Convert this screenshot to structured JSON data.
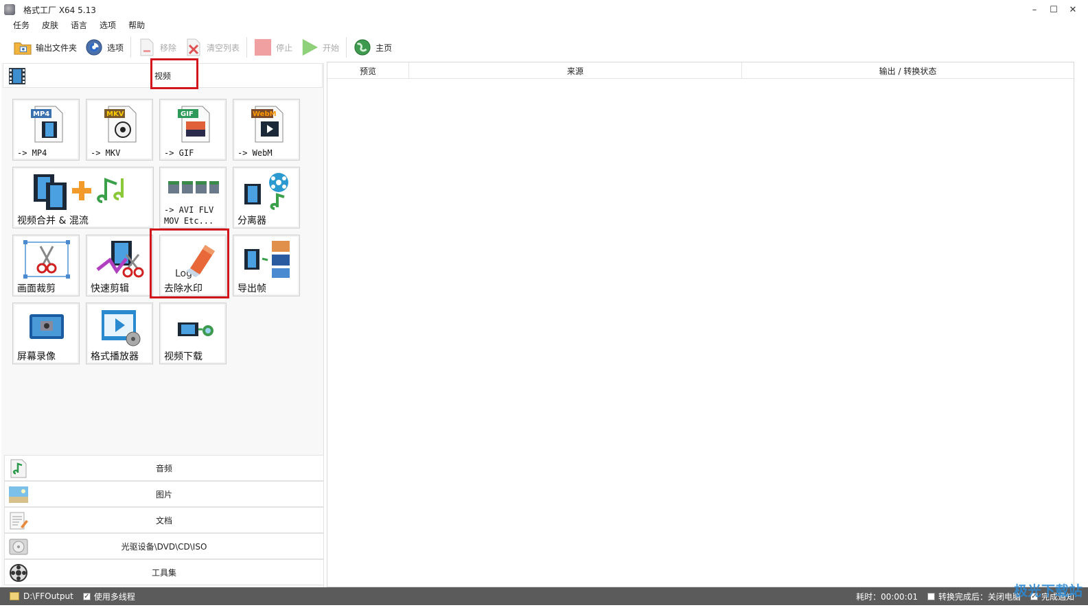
{
  "window": {
    "title": "格式工厂 X64 5.13",
    "minimize": "–",
    "maximize": "☐",
    "close": "✕"
  },
  "menu": [
    "任务",
    "皮肤",
    "语言",
    "选项",
    "帮助"
  ],
  "toolbar": {
    "output_folder": "输出文件夹",
    "options": "选项",
    "remove": "移除",
    "clear_list": "清空列表",
    "stop": "停止",
    "start": "开始",
    "home": "主页"
  },
  "video_category": {
    "label": "视频",
    "tiles": [
      {
        "label": "-> MP4",
        "icon": "mp4-file-icon",
        "badge": "MP4"
      },
      {
        "label": "-> MKV",
        "icon": "mkv-file-icon",
        "badge": "MKV"
      },
      {
        "label": "-> GIF",
        "icon": "gif-file-icon",
        "badge": "GIF"
      },
      {
        "label": "-> WebM",
        "icon": "webm-file-icon",
        "badge": "WebM"
      },
      {
        "label": "视频合并 & 混流",
        "icon": "video-merge-icon"
      },
      {
        "label": "-> AVI FLV\nMOV Etc...",
        "icon": "other-formats-icon"
      },
      {
        "label": "分离器",
        "icon": "splitter-icon"
      },
      {
        "label": "画面裁剪",
        "icon": "crop-icon"
      },
      {
        "label": "快速剪辑",
        "icon": "quick-clip-icon"
      },
      {
        "label": "去除水印",
        "icon": "remove-watermark-icon",
        "icon_text": "Logo"
      },
      {
        "label": "导出帧",
        "icon": "export-frames-icon"
      },
      {
        "label": "屏幕录像",
        "icon": "screen-record-icon"
      },
      {
        "label": "格式播放器",
        "icon": "player-icon"
      },
      {
        "label": "视频下载",
        "icon": "video-download-icon"
      }
    ]
  },
  "other_categories": [
    {
      "label": "音频",
      "icon": "audio-icon"
    },
    {
      "label": "图片",
      "icon": "image-icon"
    },
    {
      "label": "文档",
      "icon": "document-icon"
    },
    {
      "label": "光驱设备\\DVD\\CD\\ISO",
      "icon": "disc-icon"
    },
    {
      "label": "工具集",
      "icon": "tools-icon"
    }
  ],
  "list_columns": [
    "预览",
    "来源",
    "输出 / 转换状态"
  ],
  "status": {
    "output_path": "D:\\FFOutput",
    "multithread": "使用多线程",
    "elapsed": "耗时：00:00:01",
    "after_done": "转换完成后：关闭电脑",
    "notify": "完成通知"
  },
  "watermark": "极光下载站",
  "colors": {
    "highlight": "#d2141c",
    "statusbar": "#5b5b5b"
  }
}
